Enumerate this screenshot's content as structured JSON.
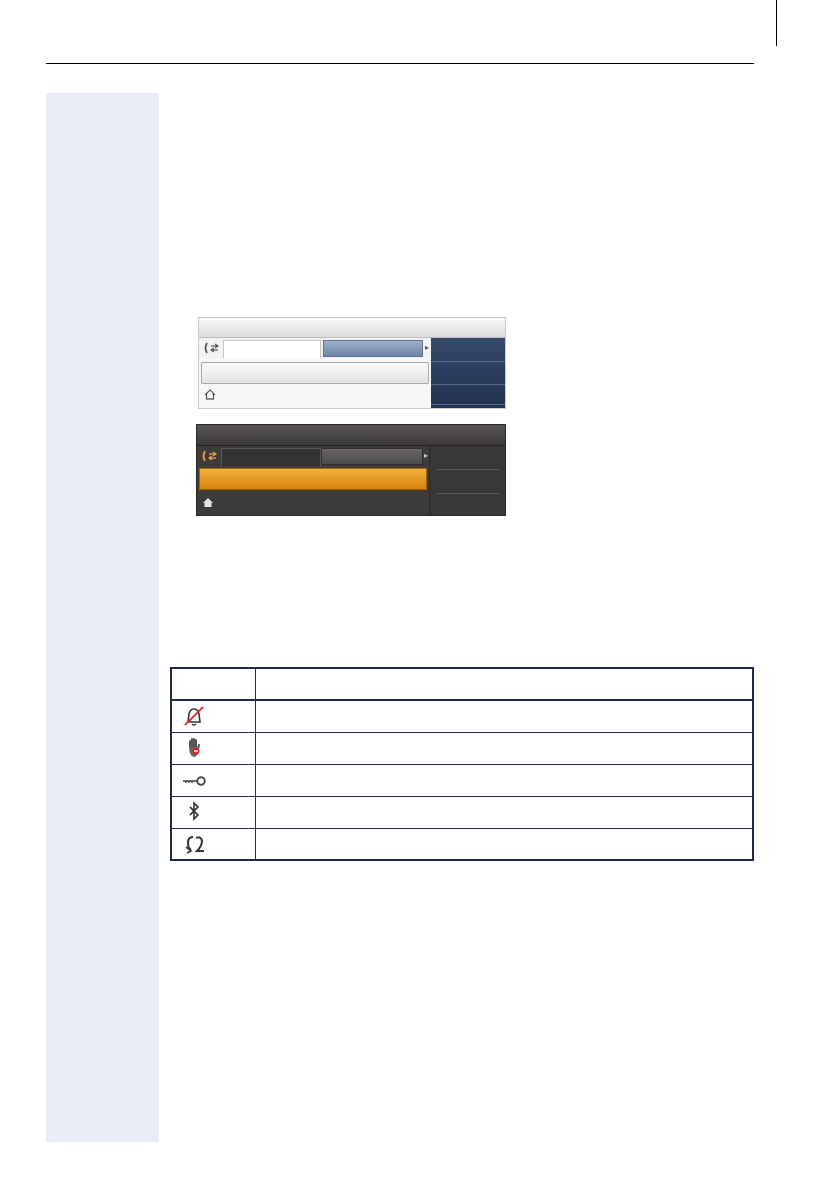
{
  "document": {
    "page": "",
    "header": ""
  },
  "screenshots": [
    {
      "theme": "light",
      "accent": "#2b3c5c"
    },
    {
      "theme": "dark",
      "accent": "#e99a22"
    }
  ],
  "icon_table": {
    "headers": [
      "",
      ""
    ],
    "rows": [
      {
        "icon": "ringer-off-icon",
        "description": ""
      },
      {
        "icon": "do-not-disturb-icon",
        "description": ""
      },
      {
        "icon": "lock-key-icon",
        "description": ""
      },
      {
        "icon": "bluetooth-icon",
        "description": ""
      },
      {
        "icon": "call-forwarding-icon",
        "description": ""
      }
    ]
  }
}
